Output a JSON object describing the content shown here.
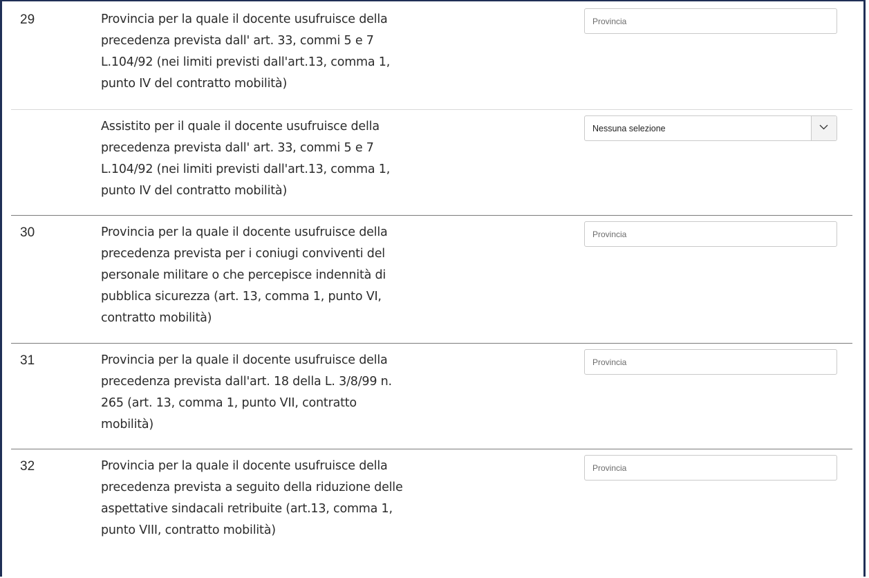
{
  "rows": [
    {
      "number": "29",
      "description": "Provincia per la quale il docente usufruisce della precedenza prevista dall' art. 33, commi 5 e 7 L.104/92 (nei limiti previsti dall'art.13, comma 1, punto IV del contratto mobilità)",
      "placeholder": "Provincia"
    },
    {
      "number": "",
      "description": "Assistito per il quale il docente usufruisce della precedenza prevista dall' art. 33, commi 5 e 7 L.104/92 (nei limiti previsti dall'art.13, comma 1, punto IV del contratto mobilità)",
      "select_value": "Nessuna selezione"
    },
    {
      "number": "30",
      "description": "Provincia per la quale il docente usufruisce della precedenza prevista per i coniugi conviventi del personale militare o che percepisce indennità di pubblica sicurezza (art. 13, comma 1, punto VI, contratto mobilità)",
      "placeholder": "Provincia"
    },
    {
      "number": "31",
      "description": "Provincia per la quale il docente usufruisce della precedenza prevista dall'art. 18 della L. 3/8/99 n. 265 (art. 13, comma 1, punto VII, contratto mobilità)",
      "placeholder": "Provincia"
    },
    {
      "number": "32",
      "description": "Provincia per la quale il docente usufruisce della precedenza prevista a seguito della riduzione delle aspettative sindacali retribuite (art.13, comma 1, punto VIII, contratto mobilità)",
      "placeholder": "Provincia"
    }
  ],
  "icons": {
    "dropdown": "chevron-down-icon"
  }
}
